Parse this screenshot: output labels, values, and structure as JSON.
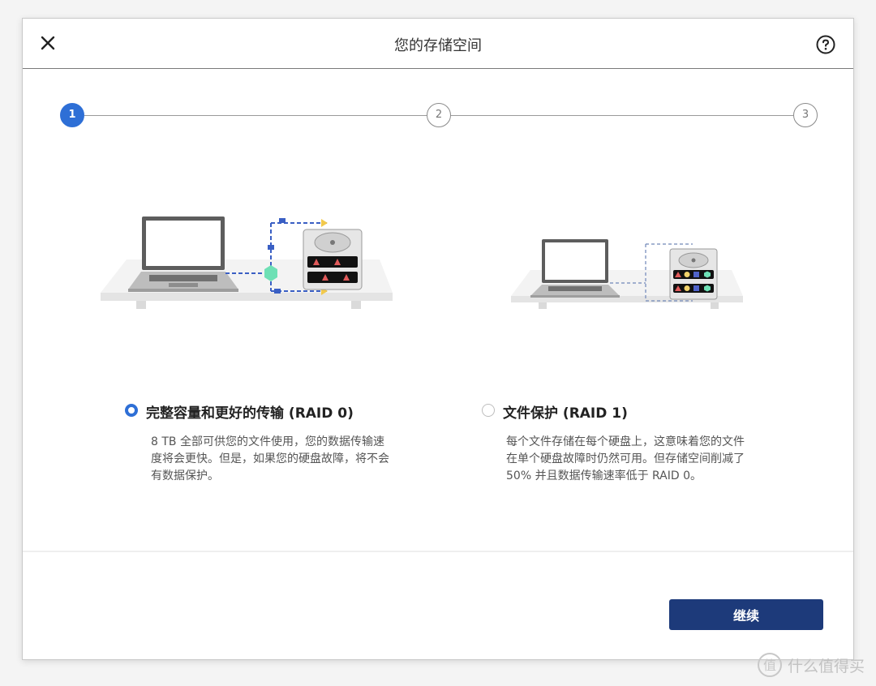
{
  "dialog": {
    "title": "您的存储空间"
  },
  "stepper": {
    "steps": [
      {
        "label": "1",
        "state": "active"
      },
      {
        "label": "2",
        "state": "inactive"
      },
      {
        "label": "3",
        "state": "inactive"
      }
    ]
  },
  "options": [
    {
      "title": "完整容量和更好的传输 (RAID 0)",
      "description_lines": [
        "8 TB 全部可供您的文件使用，您的数据传输速",
        "度将会更快。但是，如果您的硬盘故障，将不会",
        "有数据保护。"
      ],
      "selected": true
    },
    {
      "title": "文件保护 (RAID 1)",
      "description_lines": [
        "每个文件存储在每个硬盘上，这意味着您的文件",
        "在单个硬盘故障时仍然可用。但存储空间削减了",
        "50% 并且数据传输速率低于 RAID 0。"
      ],
      "selected": false
    }
  ],
  "footer": {
    "continue_label": "继续"
  },
  "watermark": {
    "text": "什么值得买",
    "logo_text": "值"
  },
  "colors": {
    "accent": "#2e6fd6",
    "button": "#1d3a7a",
    "connector": "#3a5fc4",
    "highlight": "#f2c94c",
    "node": "#6ee0b5"
  }
}
